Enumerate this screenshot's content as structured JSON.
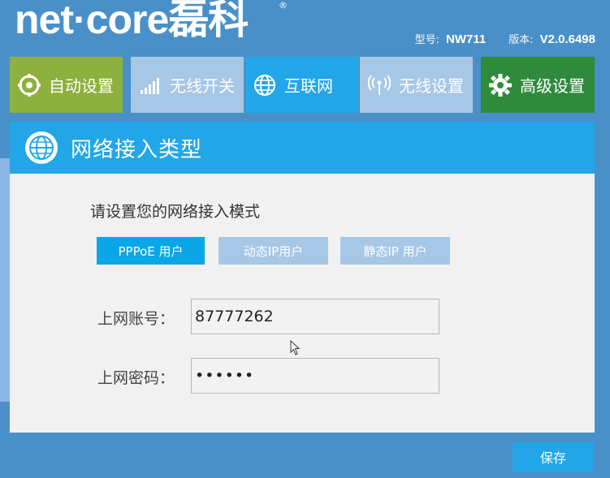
{
  "header": {
    "logo": "net·core磊科",
    "logo_reg": "®",
    "model_label": "型号:",
    "model_value": "NW711",
    "version_label": "版本:",
    "version_value": "V2.0.6498"
  },
  "nav": {
    "tabs": [
      {
        "label": "自动设置",
        "icon": "gear-sync-icon",
        "color": "#8db03e"
      },
      {
        "label": "无线开关",
        "icon": "signal-bars-icon",
        "color": "#a7c7e6"
      },
      {
        "label": "互联网",
        "icon": "globe-icon",
        "color": "#22a6e8"
      },
      {
        "label": "无线设置",
        "icon": "wifi-antenna-icon",
        "color": "#a7c7e6"
      },
      {
        "label": "高级设置",
        "icon": "gear-icon",
        "color": "#2f8a3c"
      }
    ]
  },
  "panel": {
    "title": "网络接入类型",
    "instruction": "请设置您的网络接入模式",
    "modes": [
      {
        "label": "PPPoE 用户",
        "selected": true
      },
      {
        "label": "动态IP用户",
        "selected": false
      },
      {
        "label": "静态IP 用户",
        "selected": false
      }
    ],
    "account_label": "上网账号：",
    "account_value": "87777262",
    "password_label": "上网密码：",
    "password_value": "••••••"
  },
  "footer": {
    "save_label": "保存"
  },
  "colors": {
    "background": "#4a90c8",
    "accent": "#22a6e8",
    "auto_tab": "#8db03e",
    "advanced_tab": "#2f8a3c",
    "inactive_tab": "#a7c7e6"
  }
}
